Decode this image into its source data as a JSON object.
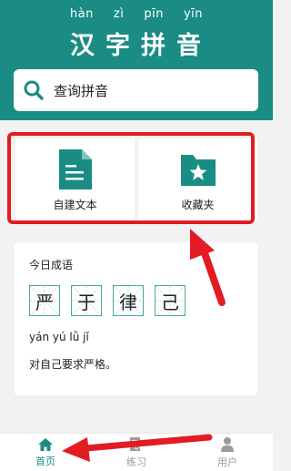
{
  "header": {
    "pinyin": [
      "hàn",
      "zì",
      "pīn",
      "yīn"
    ],
    "hanzi": [
      "汉",
      "字",
      "拼",
      "音"
    ]
  },
  "search": {
    "label": "查询拼音",
    "icon": "search-icon"
  },
  "actions": [
    {
      "label": "自建文本",
      "icon": "document-icon"
    },
    {
      "label": "收藏夹",
      "icon": "star-folder-icon"
    }
  ],
  "idiom": {
    "heading": "今日成语",
    "chars": [
      "严",
      "于",
      "律",
      "己"
    ],
    "pinyin": "yán yú lǜ jǐ",
    "meaning": "对自己要求严格。"
  },
  "tabs": [
    {
      "label": "首页",
      "icon": "home-icon",
      "active": true
    },
    {
      "label": "练习",
      "icon": "practice-icon",
      "active": false
    },
    {
      "label": "用户",
      "icon": "user-icon",
      "active": false
    }
  ],
  "colors": {
    "brand": "#1a8c84",
    "annotation": "#e31b23",
    "background": "#f2f2f2"
  }
}
